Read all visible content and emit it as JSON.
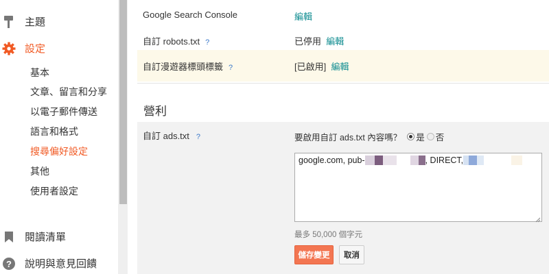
{
  "sidebar": {
    "theme_label": "主題",
    "settings_label": "設定",
    "sub_items": [
      "基本",
      "文章、留言和分享",
      "以電子郵件傳送",
      "語言和格式",
      "搜尋偏好設定",
      "其他",
      "使用者設定"
    ],
    "reading_list_label": "閱讀清單",
    "help_label": "說明與意見回饋"
  },
  "settings_rows": {
    "search_console": {
      "label": "Google Search Console",
      "edit": "編輯"
    },
    "robots": {
      "label": "自訂 robots.txt",
      "help": "?",
      "status": "已停用",
      "edit": "編輯"
    },
    "crawler_tags": {
      "label": "自訂漫遊器標頭標籤",
      "help": "?",
      "status": "[已啟用]",
      "edit": "編輯"
    }
  },
  "monetization": {
    "section_title": "營利",
    "ads_label": "自訂 ads.txt",
    "ads_help": "?",
    "question": "要啟用自訂 ads.txt 內容嗎？",
    "yes_label": "是",
    "no_label": "否",
    "content_prefix": "google.com, pub-",
    "content_direct": ", DIRECT,",
    "char_limit": "最多 50,000 個字元",
    "save_label": "儲存變更",
    "cancel_label": "取消"
  },
  "colors": {
    "accent": "#f15a24",
    "link": "#138e92",
    "save_button": "#f37652",
    "highlight_row": "#fdf9e9"
  }
}
